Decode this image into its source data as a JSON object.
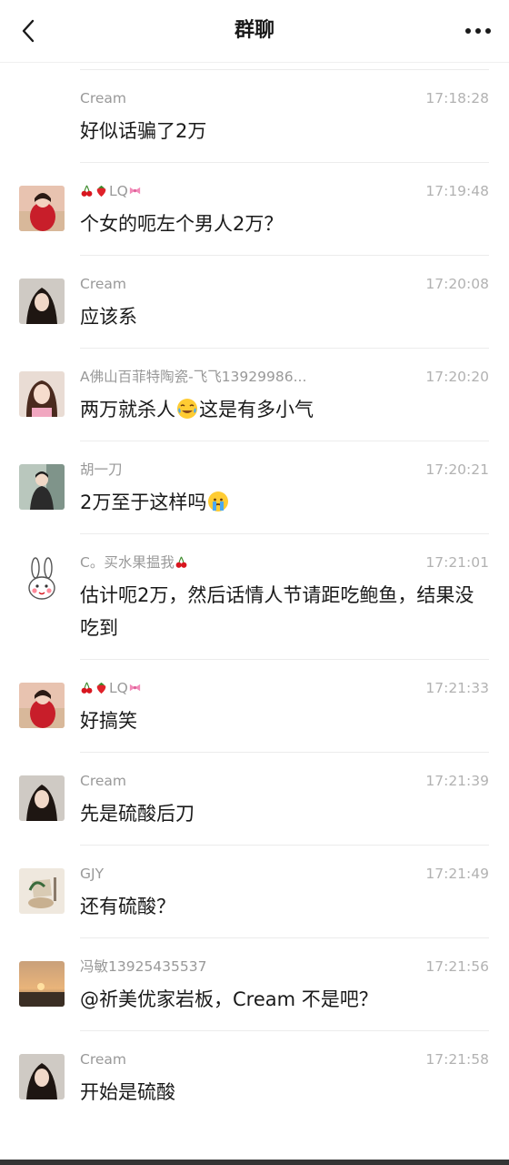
{
  "header": {
    "title": "群聊"
  },
  "messages": [
    {
      "sender": "Cream",
      "time": "17:18:28",
      "text": "好似话骗了2万"
    },
    {
      "sender": "LQ",
      "time": "17:19:48",
      "text": "个女的呃左个男人2万？"
    },
    {
      "sender": "Cream",
      "time": "17:20:08",
      "text": "应该系"
    },
    {
      "sender": "A佛山百菲特陶瓷-飞飞13929986...",
      "time": "17:20:20",
      "text_before": "两万就杀人",
      "text_after": "这是有多小气"
    },
    {
      "sender": "胡一刀",
      "time": "17:20:21",
      "text_before": "2万至于这样吗",
      "text_after": ""
    },
    {
      "sender_before": "C。买水果揾我",
      "time": "17:21:01",
      "text": "估计呃2万，然后话情人节请距吃鲍鱼，结果没吃到"
    },
    {
      "sender": "LQ",
      "time": "17:21:33",
      "text": "好搞笑"
    },
    {
      "sender": "Cream",
      "time": "17:21:39",
      "text": "先是硫酸后刀"
    },
    {
      "sender": "GJY",
      "time": "17:21:49",
      "text": "还有硫酸？"
    },
    {
      "sender": "冯敏13925435537",
      "time": "17:21:56",
      "text": "@祈美优家岩板，Cream 不是吧？"
    },
    {
      "sender": "Cream",
      "time": "17:21:58",
      "text": "开始是硫酸"
    }
  ],
  "icons": {
    "back": "chevron-left-icon",
    "more": "more-horizontal-icon",
    "cherry": "cherry-icon",
    "strawberry": "strawberry-icon",
    "bow": "bow-icon",
    "laugh_cry": "laugh-cry-emoji",
    "cry": "cry-emoji"
  },
  "colors": {
    "background": "#ffffff",
    "text_primary": "#1a1a1a",
    "text_secondary": "#999999",
    "time": "#b2b2b2",
    "divider": "#ececec"
  }
}
